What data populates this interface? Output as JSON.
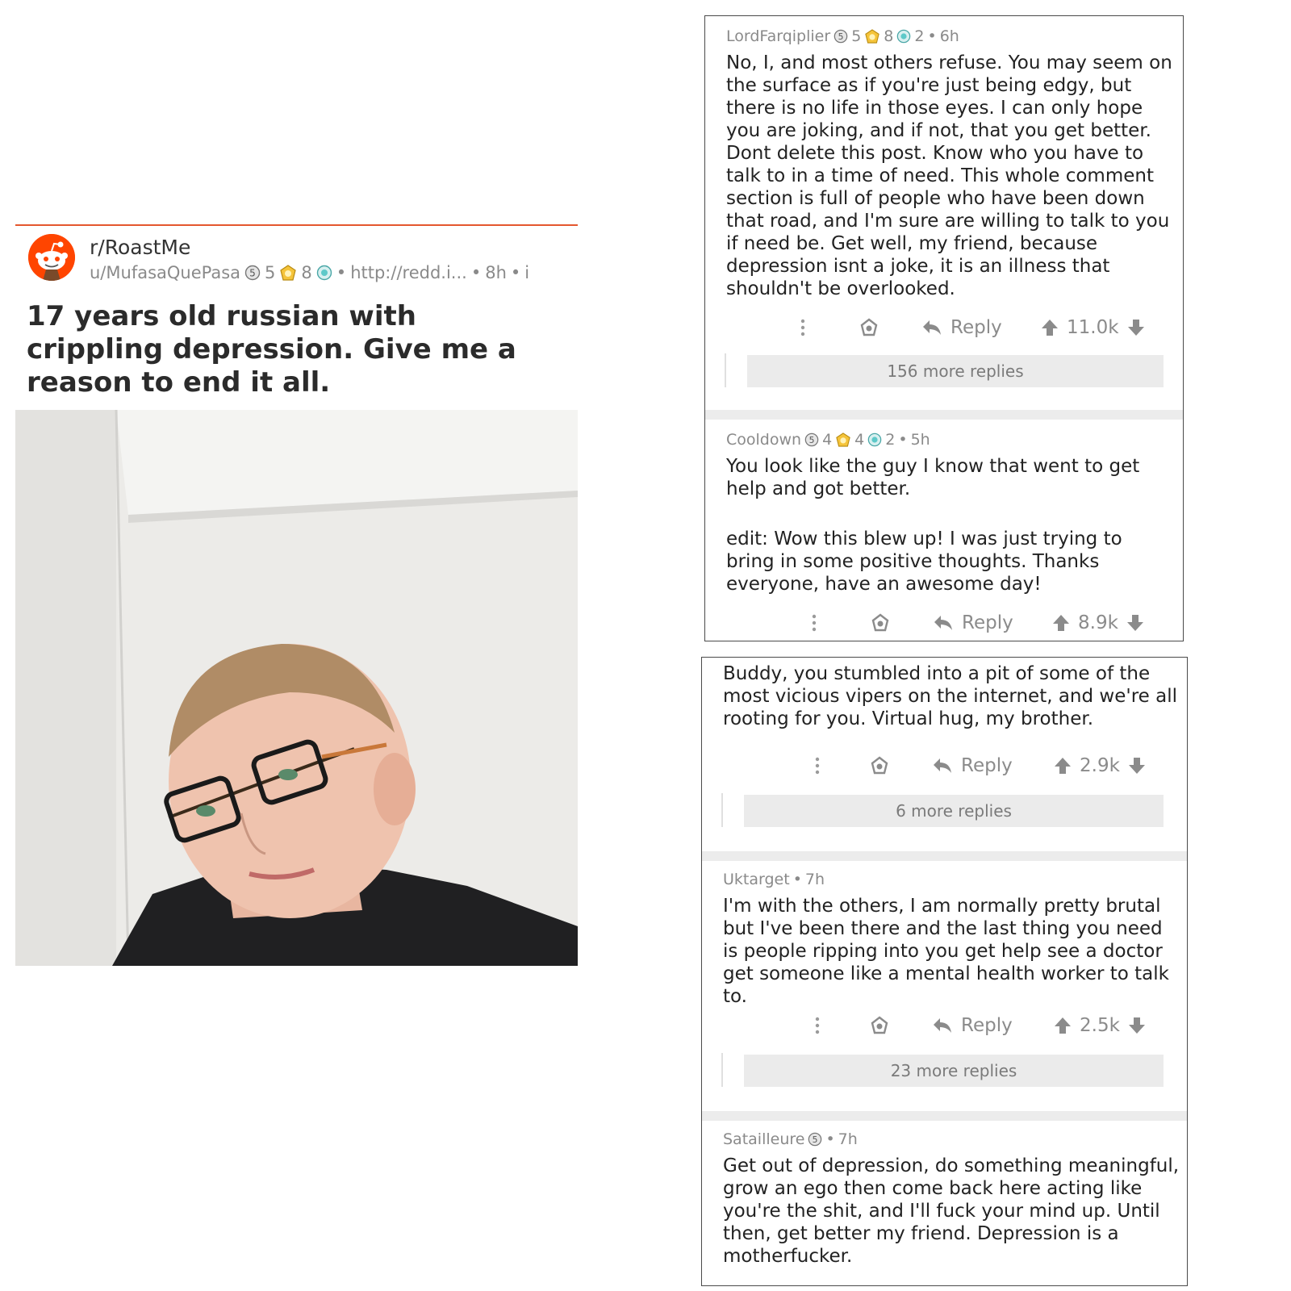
{
  "post": {
    "subreddit": "r/RoastMe",
    "username": "u/MufasaQuePasa",
    "silver_count": "5",
    "gold_count": "8",
    "separator": "•",
    "link": "http://redd.i...",
    "age": "8h",
    "info": "i",
    "title": "17 years old russian with crippling depression. Give me a reason to end it all."
  },
  "comments": [
    {
      "author": "LordFarqiplier",
      "silver": "5",
      "gold": "8",
      "platinum": "2",
      "age": "6h",
      "paragraphs": [
        "No, I, and most others refuse. You may seem on the surface as if you're just being edgy, but there is no life in those eyes. I can only hope you are joking, and if not, that you get better. Dont delete this post. Know who you have to talk to in a time of need. This whole comment section is full of people who have been down that road, and I'm sure are willing to talk to you if need be. Get well, my friend, because depression isnt a joke, it is an illness that shouldn't be overlooked."
      ],
      "reply_label": "Reply",
      "score": "11.0k",
      "more_replies": "156 more replies"
    },
    {
      "author": "Cooldown",
      "silver": "4",
      "gold": "4",
      "platinum": "2",
      "age": "5h",
      "paragraphs": [
        "You look like the guy I know that went to get help and got better.",
        "edit: Wow this blew up! I was just trying to bring in some positive thoughts. Thanks everyone, have an awesome day!"
      ],
      "reply_label": "Reply",
      "score": "8.9k"
    },
    {
      "paragraphs": [
        "Buddy, you stumbled into a pit of some of the most vicious vipers on the internet, and we're all rooting for you.  Virtual hug, my brother."
      ],
      "reply_label": "Reply",
      "score": "2.9k",
      "more_replies": "6 more replies"
    },
    {
      "author": "Uktarget",
      "age": "7h",
      "paragraphs": [
        "I'm with the others, I am normally pretty brutal but I've been there and the last thing you need is people ripping into you get help see a doctor get someone like a mental health worker to talk to."
      ],
      "reply_label": "Reply",
      "score": "2.5k",
      "more_replies": "23 more replies"
    },
    {
      "author": "Satailleure",
      "silver": "5",
      "age": "7h",
      "paragraphs": [
        "Get out of depression, do something meaningful, grow an ego then come back here acting like you're the shit, and I'll fuck your mind up. Until then, get better my friend. Depression is a motherfucker."
      ]
    }
  ],
  "colors": {
    "reddit_orange": "#ff4500",
    "header_rule": "#e4572e",
    "meta_gray": "#8a8a8a",
    "action_gray": "#8b8b8b",
    "more_replies_bg": "#ebebeb"
  },
  "icons": [
    "reddit-snoo-icon",
    "silver-award-icon",
    "gold-award-icon",
    "platinum-award-icon",
    "more-options-icon",
    "give-award-icon",
    "reply-arrow-icon",
    "upvote-arrow-icon",
    "downvote-arrow-icon"
  ]
}
